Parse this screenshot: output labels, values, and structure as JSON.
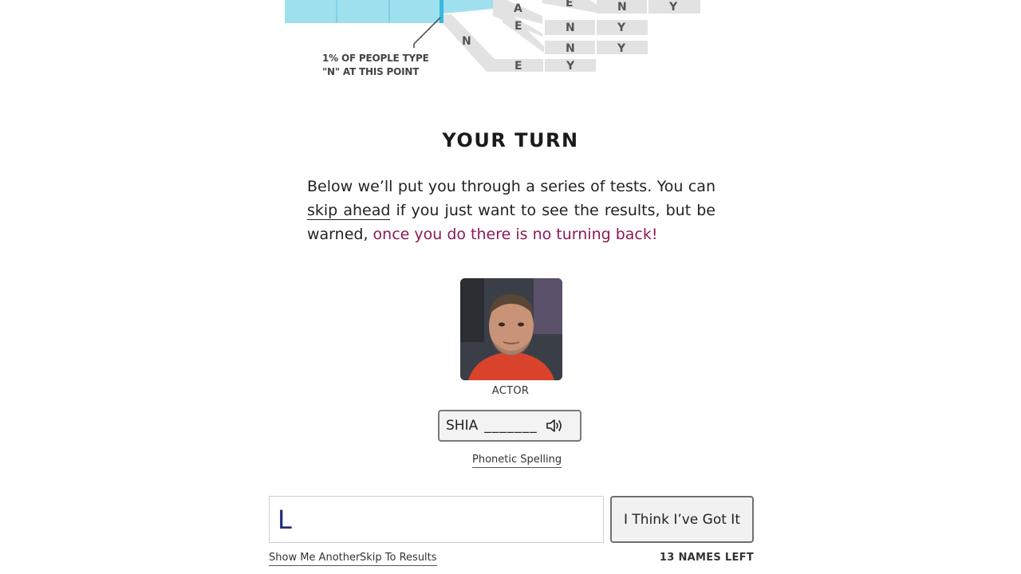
{
  "tree": {
    "annotation_line1": "1% OF PEOPLE TYPE",
    "annotation_line2": "\"N\" AT THIS POINT",
    "letters": {
      "top_row": [
        "A",
        "E",
        "N",
        "Y"
      ],
      "row2": [
        "E",
        "N",
        "Y"
      ],
      "row3": [
        "N",
        "Y"
      ],
      "branch_n": "N",
      "row4": [
        "E",
        "Y"
      ]
    },
    "colors": {
      "bar": "#9fe0ef",
      "bar_edge": "#38b8dc",
      "branch": "#e2e2e2",
      "letter": "#555555"
    }
  },
  "section": {
    "title": "YOUR TURN"
  },
  "intro": {
    "part1": "Below we’ll put you through a series of tests. You can ",
    "skip_link": "skip ahead",
    "part2": " if you just want to see the results, but be warned, ",
    "warning": "once you do there is no turning back!",
    "warning_color": "#8b1a55"
  },
  "quiz": {
    "occupation": "ACTOR",
    "hint_first": "SHIA",
    "hint_blank": "_______",
    "speaker_icon": "speaker-icon",
    "phonetic_label": "Phonetic Spelling",
    "answer_value": "L",
    "submit_label": "I Think I’ve Got It",
    "show_another": "Show Me Another",
    "skip_results": "Skip To Results",
    "names_left": "13 NAMES LEFT"
  }
}
